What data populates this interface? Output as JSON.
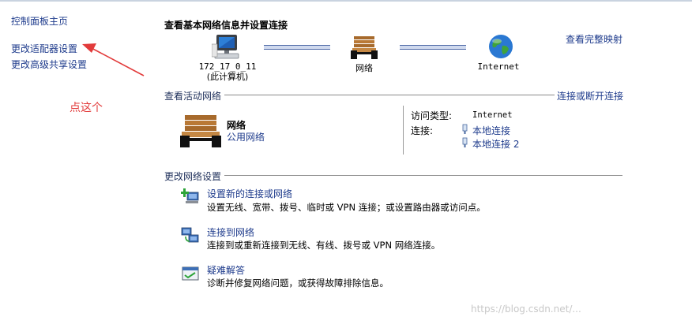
{
  "sidebar": {
    "home": "控制面板主页",
    "items": [
      {
        "label": "更改适配器设置"
      },
      {
        "label": "更改高级共享设置"
      }
    ]
  },
  "annotation": {
    "text": "点这个",
    "color": "#e23b3b"
  },
  "map": {
    "heading": "查看基本网络信息并设置连接",
    "full_map_link": "查看完整映射",
    "computer_name": "172_17_0_11",
    "computer_sub": "(此计算机)",
    "network_label": "网络",
    "internet_label": "Internet"
  },
  "active": {
    "title": "查看活动网络",
    "connect_link": "连接或断开连接",
    "network_name": "网络",
    "network_type": "公用网络",
    "access_type_label": "访问类型:",
    "access_type_value": "Internet",
    "connections_label": "连接:",
    "connections": [
      "本地连接",
      "本地连接 2"
    ]
  },
  "change": {
    "title": "更改网络设置",
    "tasks": [
      {
        "title": "设置新的连接或网络",
        "desc": "设置无线、宽带、拨号、临时或 VPN 连接；或设置路由器或访问点。",
        "icon": "new-connection-icon"
      },
      {
        "title": "连接到网络",
        "desc": "连接到或重新连接到无线、有线、拨号或 VPN 网络连接。",
        "icon": "connect-network-icon"
      },
      {
        "title": "疑难解答",
        "desc": "诊断并修复网络问题，或获得故障排除信息。",
        "icon": "troubleshoot-icon"
      }
    ]
  },
  "watermark": "https://blog.csdn.net/...",
  "colors": {
    "link": "#1e3b8c",
    "annotation": "#e23b3b"
  }
}
